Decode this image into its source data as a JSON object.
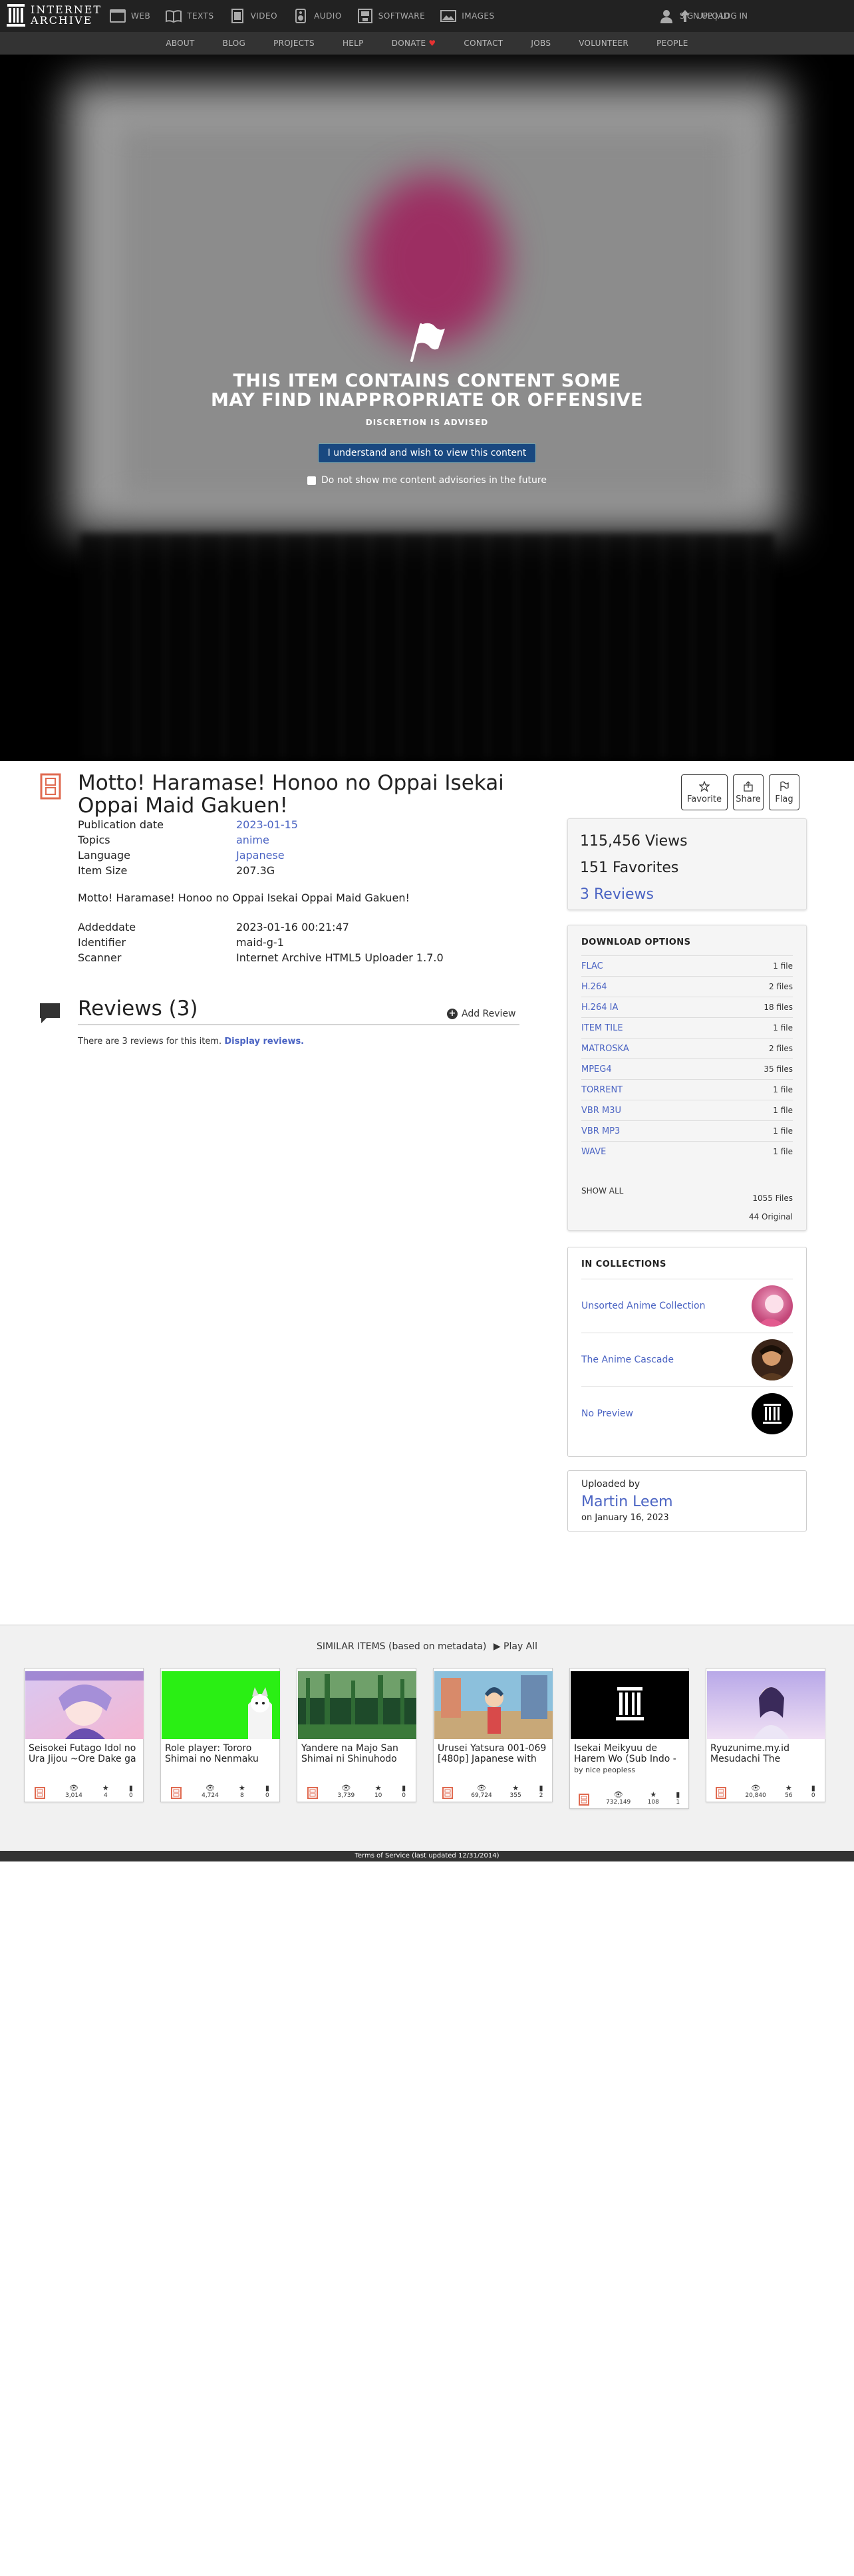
{
  "header": {
    "logo_line1": "INTERNET",
    "logo_line2": "ARCHIVE",
    "nav": [
      {
        "label": "WEB",
        "icon": "web-icon"
      },
      {
        "label": "TEXTS",
        "icon": "texts-icon"
      },
      {
        "label": "VIDEO",
        "icon": "video-icon"
      },
      {
        "label": "AUDIO",
        "icon": "audio-icon"
      },
      {
        "label": "SOFTWARE",
        "icon": "software-icon"
      },
      {
        "label": "IMAGES",
        "icon": "images-icon"
      }
    ],
    "signup": "SIGN UP | LOG IN",
    "upload": "UPLOAD"
  },
  "subnav": [
    "ABOUT",
    "BLOG",
    "PROJECTS",
    "HELP",
    "DONATE",
    "CONTACT",
    "JOBS",
    "VOLUNTEER",
    "PEOPLE"
  ],
  "advisory": {
    "title_line1": "THIS ITEM CONTAINS CONTENT SOME",
    "title_line2": "MAY FIND INAPPROPRIATE OR OFFENSIVE",
    "subtitle": "DISCRETION IS ADVISED",
    "button": "I understand and wish to view this content",
    "checkbox": "Do not show me content advisories in the future"
  },
  "item": {
    "title": "Motto! Haramase! Honoo no Oppai Isekai Oppai Maid Gakuen!",
    "actions": {
      "favorite": "Favorite",
      "share": "Share",
      "flag": "Flag"
    },
    "meta": [
      {
        "key": "Publication date",
        "value": "2023-01-15",
        "link": true
      },
      {
        "key": "Topics",
        "value": "anime",
        "link": true
      },
      {
        "key": "Language",
        "value": "Japanese",
        "link": true
      },
      {
        "key": "Item Size",
        "value": "207.3G",
        "link": false
      }
    ],
    "description": "Motto! Haramase! Honoo no Oppai Isekai Oppai Maid Gakuen!",
    "meta2": [
      {
        "key": "Addeddate",
        "value": "2023-01-16 00:21:47"
      },
      {
        "key": "Identifier",
        "value": "maid-g-1"
      },
      {
        "key": "Scanner",
        "value": "Internet Archive HTML5 Uploader 1.7.0"
      }
    ]
  },
  "reviews": {
    "title": "Reviews (3)",
    "add": "Add Review",
    "note": "There are 3 reviews for this item.",
    "display": "Display reviews."
  },
  "stats": {
    "views": "115,456 Views",
    "favorites": "151 Favorites",
    "reviews": "3 Reviews"
  },
  "downloads": {
    "title": "DOWNLOAD OPTIONS",
    "rows": [
      {
        "fmt": "FLAC",
        "count": "1 file"
      },
      {
        "fmt": "H.264",
        "count": "2 files"
      },
      {
        "fmt": "H.264 IA",
        "count": "18 files"
      },
      {
        "fmt": "ITEM TILE",
        "count": "1 file"
      },
      {
        "fmt": "MATROSKA",
        "count": "2 files"
      },
      {
        "fmt": "MPEG4",
        "count": "35 files"
      },
      {
        "fmt": "TORRENT",
        "count": "1 file"
      },
      {
        "fmt": "VBR M3U",
        "count": "1 file"
      },
      {
        "fmt": "VBR MP3",
        "count": "1 file"
      },
      {
        "fmt": "WAVE",
        "count": "1 file"
      }
    ],
    "show_all": "SHOW ALL",
    "total_files": "1055 Files",
    "original": "44 Original"
  },
  "collections": {
    "title": "IN COLLECTIONS",
    "items": [
      "Unsorted Anime Collection",
      "The Anime Cascade",
      "No Preview"
    ]
  },
  "uploader": {
    "label": "Uploaded by",
    "name": "Martin Leem",
    "date": "on January 16, 2023"
  },
  "similar": {
    "heading": "SIMILAR ITEMS (based on metadata)",
    "play_all": "Play All",
    "cards": [
      {
        "title": "Seisokei Futago Idol no Ura Jijou ~Ore Dake ga",
        "by": "",
        "views": "3,014",
        "favs": "4",
        "reviews": "0"
      },
      {
        "title": "Role player: Tororo Shimai no Nenmaku",
        "by": "",
        "views": "4,724",
        "favs": "8",
        "reviews": "0"
      },
      {
        "title": "Yandere na Majo San Shimai ni Shinuhodo",
        "by": "",
        "views": "3,739",
        "favs": "10",
        "reviews": "0"
      },
      {
        "title": "Urusei Yatsura 001-069 [480p] Japanese with",
        "by": "",
        "views": "69,724",
        "favs": "355",
        "reviews": "2"
      },
      {
        "title": "Isekai Meikyuu de Harem Wo (Sub Indo -",
        "by": "by nice peopless",
        "views": "732,149",
        "favs": "108",
        "reviews": "1"
      },
      {
        "title": "Ryuzunime.my.id Mesudachi The",
        "by": "",
        "views": "20,840",
        "favs": "56",
        "reviews": "0"
      }
    ]
  },
  "footer": "Terms of Service (last updated 12/31/2014)"
}
